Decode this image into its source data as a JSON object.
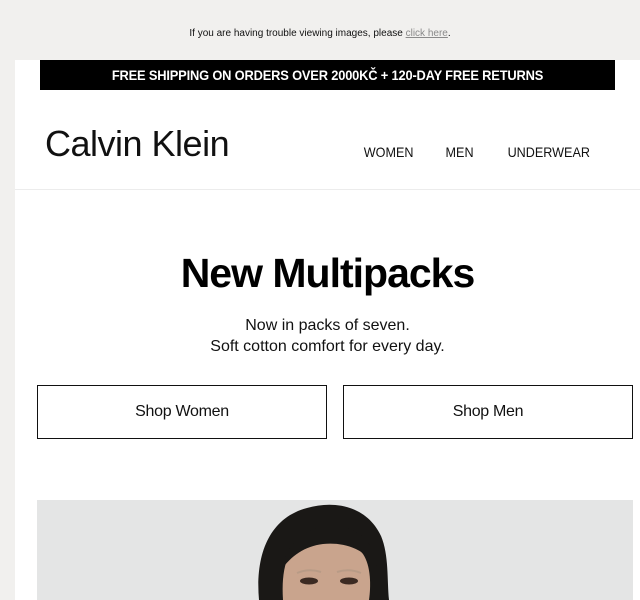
{
  "preheader": {
    "text": "If you are having trouble viewing images, please ",
    "link_label": "click here",
    "suffix": "."
  },
  "promo": {
    "text": "FREE SHIPPING ON ORDERS OVER 2000KČ + 120-DAY FREE RETURNS"
  },
  "header": {
    "logo": "Calvin Klein",
    "nav": [
      "WOMEN",
      "MEN",
      "UNDERWEAR"
    ]
  },
  "hero_text": {
    "headline": "New Multipacks",
    "line1": "Now in packs of seven.",
    "line2": "Soft cotton comfort for every day."
  },
  "buttons": {
    "women": "Shop Women",
    "men": "Shop Men"
  },
  "colors": {
    "page_bg": "#f1f0ee",
    "promo_bg": "#000000",
    "hero_bg": "#e4e5e5"
  }
}
